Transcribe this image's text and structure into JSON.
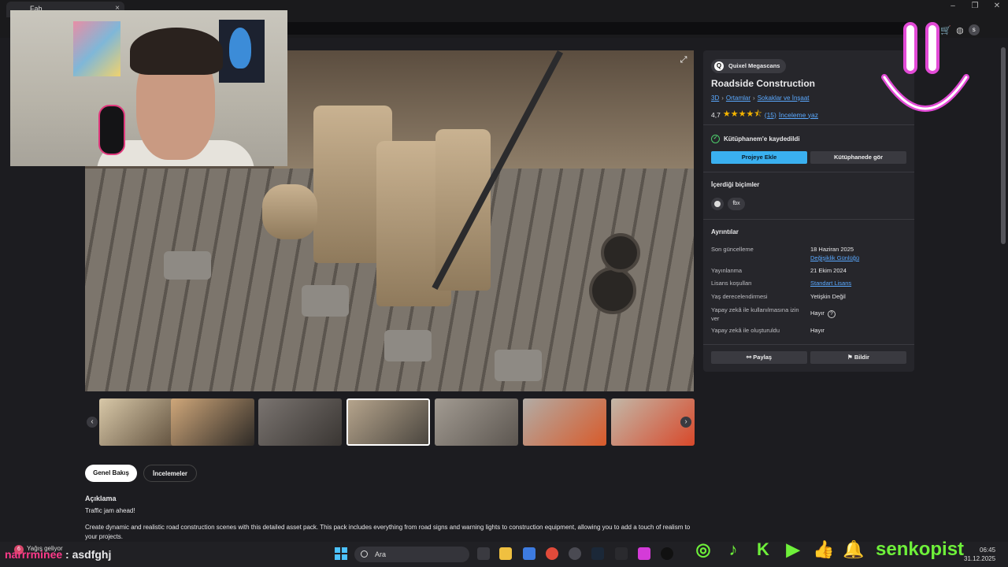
{
  "browser": {
    "tab_title": "Fab",
    "tab_close": "×",
    "window_controls": [
      "–",
      "❐",
      "✕"
    ],
    "avatar_initial": "s"
  },
  "hero": {
    "expand_icon": "expand-icon"
  },
  "thumbnails": {
    "count": 7,
    "selected_index": 3,
    "prev": "‹",
    "next": "›"
  },
  "tabs": {
    "overview": "Genel Bakış",
    "reviews": "İncelemeler"
  },
  "description": {
    "heading": "Açıklama",
    "line1": "Traffic jam ahead!",
    "line2": "Create dynamic and realistic road construction scenes with this detailed asset pack. This pack includes everything from road signs and warning lights to construction equipment, allowing you to add a touch of realism to your projects."
  },
  "panel": {
    "brand": "Quixel Megascans",
    "title": "Roadside Construction",
    "breadcrumbs": [
      "3D",
      "Ortamlar",
      "Sokaklar ve İnşaat"
    ],
    "rating_value": "4,7",
    "rating_stars": 4.7,
    "rating_count": "(15)",
    "write_review": "İnceleme yaz",
    "saved_text": "Kütüphanem'e kaydedildi",
    "add_to_project": "Projeye Ekle",
    "view_in_library": "Kütüphanede gör",
    "formats_label": "İçerdiği biçimler",
    "format_fbx": "fbx",
    "details_label": "Ayrıntılar",
    "details": {
      "last_update_key": "Son güncelleme",
      "last_update_val": "18 Haziran 2025",
      "changelog": "Değişiklik Günlüğü",
      "published_key": "Yayınlanma",
      "published_val": "21 Ekim 2024",
      "license_key": "Lisans koşulları",
      "license_val": "Standart Lisans",
      "age_key": "Yaş derecelendirmesi",
      "age_val": "Yetişkin Değil",
      "ai_use_key": "Yapay zekâ ile kullanılmasına izin ver",
      "ai_use_val": "Hayır",
      "ai_made_key": "Yapay zekâ ile oluşturuldu",
      "ai_made_val": "Hayır"
    },
    "share": "Paylaş",
    "report": "Bildir"
  },
  "taskbar": {
    "weather": "Yağış geliyor",
    "weather_badge": "6",
    "search_placeholder": "Ara",
    "time": "06:45",
    "date": "31.12.2025"
  },
  "overlay": {
    "chat_user": "narrrminee",
    "chat_message": " : asdfghj",
    "brand_name": "senkopist"
  },
  "colors": {
    "accent_blue": "#3ab0f0",
    "link": "#5aa9ff",
    "star": "#f4b400",
    "social_green": "#6ef03a",
    "smiley_pink": "#e24ad6"
  }
}
